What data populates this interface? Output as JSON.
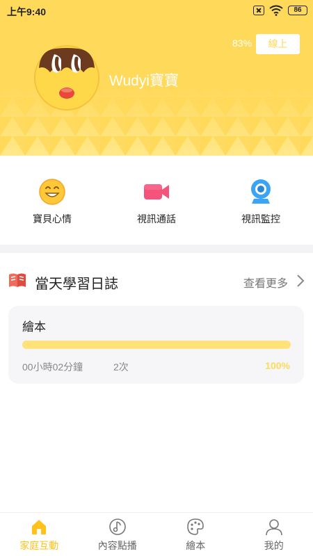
{
  "status_bar": {
    "time": "上午9:40",
    "battery": "86"
  },
  "header": {
    "battery_pct": "83%",
    "online_label": "線上",
    "baby_name": "Wudyi寶寶",
    "bg_color": "#ffd95a"
  },
  "actions": [
    {
      "label": "寶貝心情",
      "icon": "smiley-icon"
    },
    {
      "label": "視訊通話",
      "icon": "video-camera-icon"
    },
    {
      "label": "視訊監控",
      "icon": "webcam-icon"
    }
  ],
  "log": {
    "title": "當天學習日誌",
    "more_label": "查看更多",
    "card": {
      "title": "繪本",
      "duration": "00小時02分鐘",
      "count": "2次",
      "percent": "100%",
      "progress": 1.0
    }
  },
  "nav": [
    {
      "label": "家庭互動",
      "icon": "home-icon",
      "active": true
    },
    {
      "label": "內容點播",
      "icon": "music-note-icon",
      "active": false
    },
    {
      "label": "繪本",
      "icon": "palette-icon",
      "active": false
    },
    {
      "label": "我的",
      "icon": "person-icon",
      "active": false
    }
  ],
  "colors": {
    "accent": "#ffd95a",
    "active_nav": "#ffc21a"
  }
}
